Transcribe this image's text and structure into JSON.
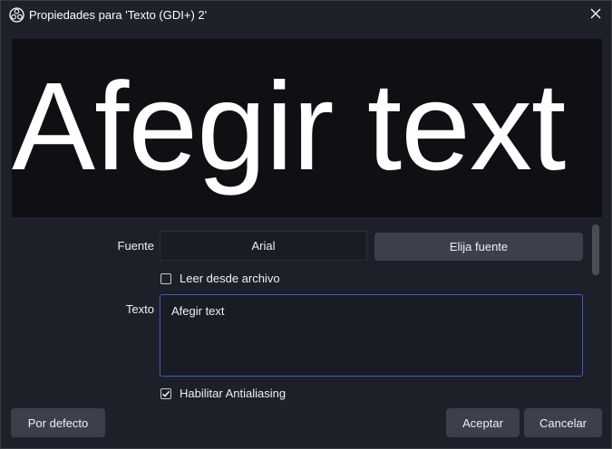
{
  "window": {
    "title": "Propiedades para 'Texto (GDI+) 2'",
    "icons": {
      "app": "obs-icon",
      "close": "close-icon"
    }
  },
  "preview": {
    "text": "Afegir text",
    "background": "#101014",
    "text_color": "#ffffff"
  },
  "properties": {
    "font_label": "Fuente",
    "font_value": "Arial",
    "choose_font_button": "Elija fuente",
    "read_from_file": {
      "label": "Leer desde archivo",
      "checked": false
    },
    "text_label": "Texto",
    "text_value": "Afegir text",
    "antialiasing": {
      "label": "Habilitar Antialiasing",
      "checked": true
    }
  },
  "footer": {
    "defaults_button": "Por defecto",
    "ok_button": "Aceptar",
    "cancel_button": "Cancelar"
  },
  "colors": {
    "accent_border": "#3c5cc8",
    "button_bg": "#3c404d",
    "window_bg": "#1f212a"
  }
}
